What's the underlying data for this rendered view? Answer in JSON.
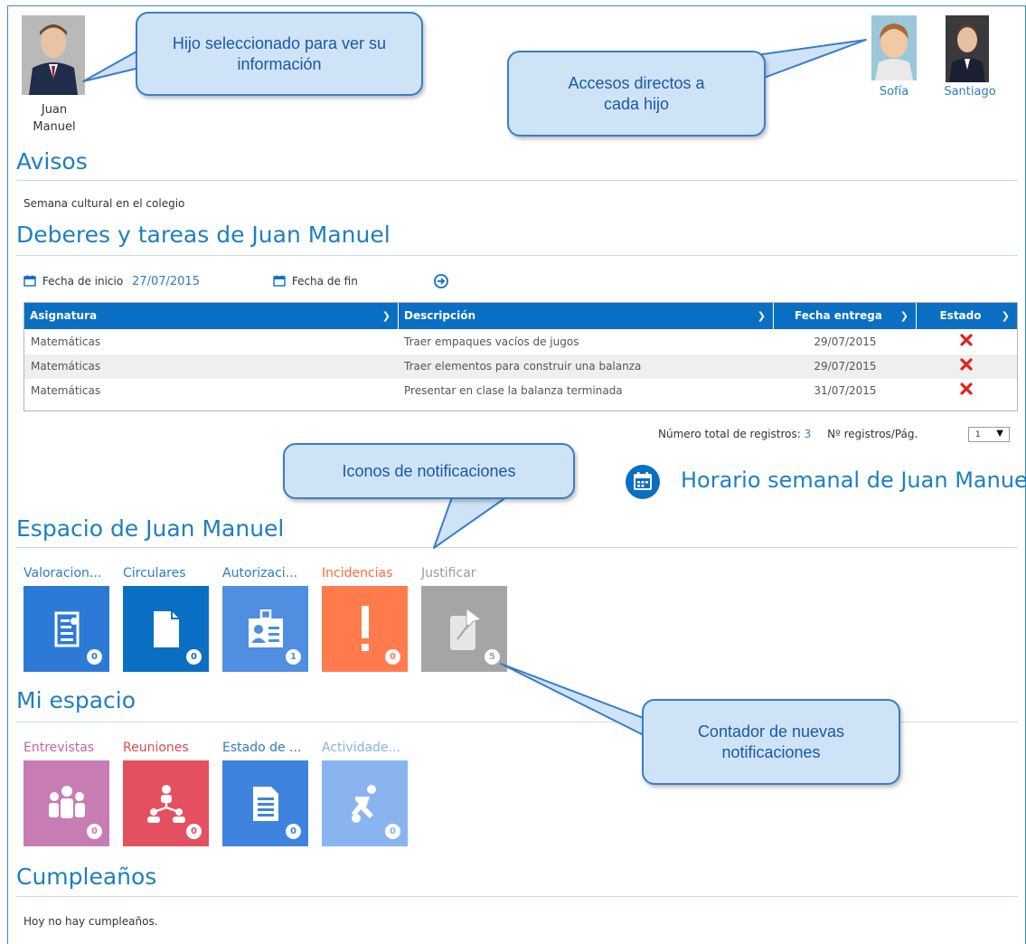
{
  "selected_child": {
    "first": "Juan",
    "last": "Manuel"
  },
  "siblings": [
    {
      "name": "Sofía"
    },
    {
      "name": "Santiago"
    }
  ],
  "sections": {
    "avisos": "Avisos",
    "deberes": "Deberes y tareas de Juan Manuel",
    "espacio": "Espacio de Juan Manuel",
    "mi_espacio": "Mi espacio",
    "cumple": "Cumpleaños"
  },
  "avisos_text": "Semana cultural en el colegio",
  "filters": {
    "start_label": "Fecha de inicio",
    "start_value": "27/07/2015",
    "end_label": "Fecha de fin"
  },
  "table": {
    "headers": [
      "Asignatura",
      "Descripción",
      "Fecha entrega",
      "Estado"
    ],
    "rows": [
      {
        "subject": "Matemáticas",
        "description": "Traer empaques vacíos de jugos",
        "date": "29/07/2015"
      },
      {
        "subject": "Matemáticas",
        "description": "Traer elementos para construir una balanza",
        "date": "29/07/2015"
      },
      {
        "subject": "Matemáticas",
        "description": "Presentar en clase la balanza terminada",
        "date": "31/07/2015"
      }
    ]
  },
  "pager": {
    "total_label": "Número total de registros:",
    "total_value": "3",
    "per_page_label": "Nº registros/Pág.",
    "per_page_value": "1"
  },
  "schedule_link": "Horario semanal de Juan Manuel",
  "espacio_tiles": [
    {
      "label": "Valoracion...",
      "count": "0",
      "color": "#2d7ad6",
      "label_color": "#2d7cc2"
    },
    {
      "label": "Circulares",
      "count": "0",
      "color": "#0a6fc2",
      "label_color": "#2d7cc2"
    },
    {
      "label": "Autorizaci...",
      "count": "1",
      "color": "#4f8ee0",
      "label_color": "#2d7cc2"
    },
    {
      "label": "Incidencias",
      "count": "0",
      "color": "#ff7b4e",
      "label_color": "#ff6a3d"
    },
    {
      "label": "Justificar",
      "count": "5",
      "color": "#a5a5a5",
      "label_color": "#9a9a9a"
    }
  ],
  "mi_tiles": [
    {
      "label": "Entrevistas",
      "count": "0",
      "color": "#c77db3",
      "label_color": "#c2659f"
    },
    {
      "label": "Reuniones",
      "count": "0",
      "color": "#e4505f",
      "label_color": "#e04856"
    },
    {
      "label": "Estado de ...",
      "count": "0",
      "color": "#3e84de",
      "label_color": "#2d7cc2"
    },
    {
      "label": "Actividade...",
      "count": "0",
      "color": "#8ab4ef",
      "label_color": "#8ab0e8"
    }
  ],
  "cumple_text": "Hoy no hay cumpleaños.",
  "callouts": {
    "selected": "Hijo seleccionado para ver su información",
    "direct": "Accesos directos a cada hijo",
    "icons": "Iconos de notificaciones",
    "counter": "Contador de nuevas notificaciones"
  }
}
